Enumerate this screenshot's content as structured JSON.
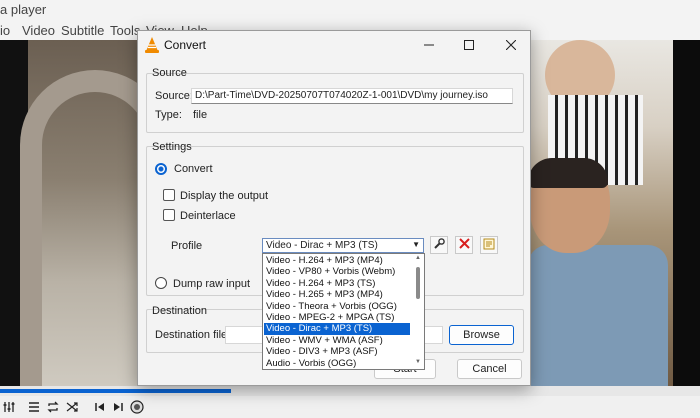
{
  "vlc": {
    "title": "a player",
    "menu": [
      "io",
      "Video",
      "Subtitle",
      "Tools",
      "View",
      "Help"
    ],
    "progress_fraction": 0.33
  },
  "dialog": {
    "title": "Convert",
    "source_group": "Source",
    "source_label": "Source:",
    "source_value": "D:\\Part-Time\\DVD-20250707T074020Z-1-001\\DVD\\my journey.iso",
    "type_label": "Type:",
    "type_value": "file",
    "settings_group": "Settings",
    "convert_label": "Convert",
    "display_output_label": "Display the output",
    "deinterlace_label": "Deinterlace",
    "profile_label": "Profile",
    "profile_selected": "Video - Dirac + MP3 (TS)",
    "profile_options": [
      "Video - H.264 + MP3 (MP4)",
      "Video - VP80 + Vorbis (Webm)",
      "Video - H.264 + MP3 (TS)",
      "Video - H.265 + MP3 (MP4)",
      "Video - Theora + Vorbis (OGG)",
      "Video - MPEG-2 + MPGA (TS)",
      "Video - Dirac + MP3 (TS)",
      "Video - WMV + WMA (ASF)",
      "Video - DIV3 + MP3 (ASF)",
      "Audio - Vorbis (OGG)"
    ],
    "dump_raw_label": "Dump raw input",
    "destination_group": "Destination",
    "destination_file_label": "Destination file:",
    "browse_label": "Browse",
    "start_label": "Start",
    "cancel_label": "Cancel"
  },
  "colors": {
    "accent": "#0a63d1",
    "vlc_orange": "#f08a00",
    "delete_red": "#d81e1e"
  }
}
